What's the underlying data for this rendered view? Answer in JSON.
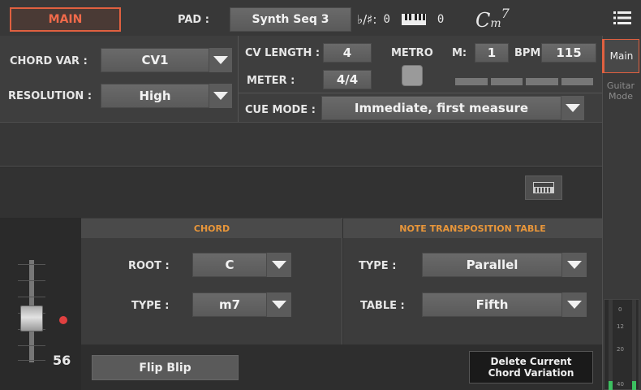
{
  "topbar": {
    "main_tab": "MAIN",
    "pad_label": "PAD :",
    "pad_value": "Synth Seq 3",
    "flat_sharp_label": "♭/♯:",
    "flat_sharp_value": "0",
    "keyboard_value": "0",
    "chord_display": "C",
    "chord_suffix_m": "m",
    "chord_suffix_7": "7"
  },
  "side_tabs": {
    "main": "Main",
    "guitar": "Guitar\nMode"
  },
  "controls": {
    "chord_var_label": "CHORD VAR :",
    "chord_var_value": "CV1",
    "resolution_label": "RESOLUTION :",
    "resolution_value": "High",
    "cv_length_label": "CV LENGTH :",
    "cv_length_value": "4",
    "meter_label": "METER :",
    "meter_value": "4/4",
    "metro_label": "METRO",
    "measure_label": "M:",
    "measure_value": "1",
    "bpm_label": "BPM :",
    "bpm_value": "115",
    "cue_mode_label": "CUE MODE :",
    "cue_mode_value": "Immediate, first measure"
  },
  "chord": {
    "header": "CHORD",
    "root_label": "ROOT :",
    "root_value": "C",
    "type_label": "TYPE :",
    "type_value": "m7"
  },
  "note_table": {
    "header": "NOTE TRANSPOSITION TABLE",
    "type_label": "TYPE :",
    "type_value": "Parallel",
    "table_label": "TABLE :",
    "table_value": "Fifth"
  },
  "fader": {
    "value": "56"
  },
  "buttons": {
    "flip_blip": "Flip Blip",
    "delete_cv_line1": "Delete Current",
    "delete_cv_line2": "Chord Variation"
  },
  "meter_scale": [
    "0",
    "12",
    "20",
    "40"
  ],
  "colors": {
    "accent": "#e06040",
    "led": "#e04040",
    "meter_green": "#3cc060"
  }
}
